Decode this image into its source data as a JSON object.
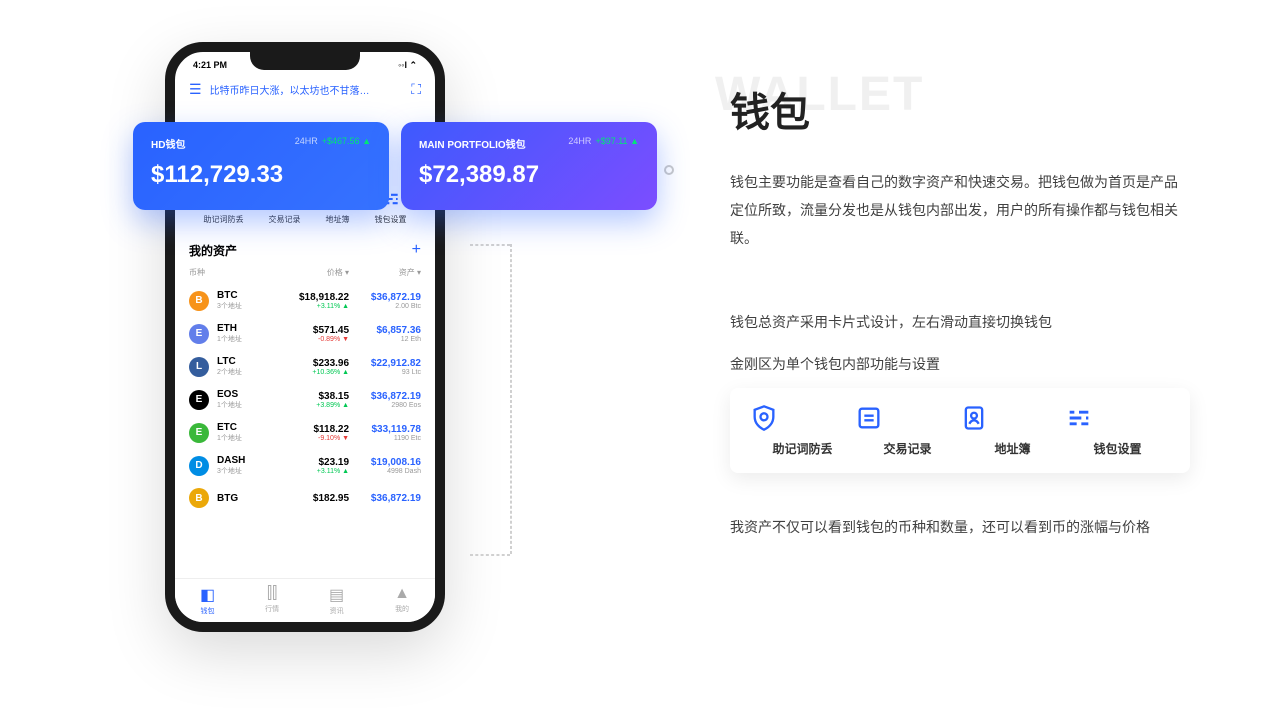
{
  "status": {
    "time": "4:21 PM",
    "signal": "◦◦l ⌃"
  },
  "news_text": "比特币昨日大涨，以太坊也不甘落…",
  "wallet_cards": [
    {
      "name": "HD钱包",
      "period": "24HR",
      "change": "+$467.56",
      "arrow": "▲",
      "amount": "$112,729.33"
    },
    {
      "name": "MAIN PORTFOLIO钱包",
      "period": "24HR",
      "change": "+$97.11",
      "arrow": "▲",
      "amount": "$72,389.87"
    }
  ],
  "actions": [
    {
      "label": "助记词防丢"
    },
    {
      "label": "交易记录"
    },
    {
      "label": "地址簿"
    },
    {
      "label": "钱包设置"
    }
  ],
  "assets_title": "我的资产",
  "col_headers": {
    "c1": "币种",
    "c2": "价格 ▾",
    "c3": "资产 ▾"
  },
  "assets": [
    {
      "sym": "BTC",
      "addr": "3个地址",
      "price": "$18,918.22",
      "change": "+3.11%",
      "dir": "up",
      "value": "$36,872.19",
      "amt": "2.00 Btc",
      "bg": "#f7931a"
    },
    {
      "sym": "ETH",
      "addr": "1个地址",
      "price": "$571.45",
      "change": "-0.89%",
      "dir": "down",
      "value": "$6,857.36",
      "amt": "12 Eth",
      "bg": "#627eea"
    },
    {
      "sym": "LTC",
      "addr": "2个地址",
      "price": "$233.96",
      "change": "+10.36%",
      "dir": "up",
      "value": "$22,912.82",
      "amt": "93 Ltc",
      "bg": "#345d9d"
    },
    {
      "sym": "EOS",
      "addr": "1个地址",
      "price": "$38.15",
      "change": "+3.89%",
      "dir": "up",
      "value": "$36,872.19",
      "amt": "2980 Eos",
      "bg": "#000"
    },
    {
      "sym": "ETC",
      "addr": "1个地址",
      "price": "$118.22",
      "change": "-9.10%",
      "dir": "down",
      "value": "$33,119.78",
      "amt": "1190 Etc",
      "bg": "#3ab83a"
    },
    {
      "sym": "DASH",
      "addr": "3个地址",
      "price": "$23.19",
      "change": "+3.11%",
      "dir": "up",
      "value": "$19,008.16",
      "amt": "4998 Dash",
      "bg": "#008de4"
    },
    {
      "sym": "BTG",
      "addr": "",
      "price": "$182.95",
      "change": "",
      "dir": "up",
      "value": "$36,872.19",
      "amt": "",
      "bg": "#eba809"
    }
  ],
  "tabs": [
    {
      "label": "钱包",
      "active": true
    },
    {
      "label": "行情",
      "active": false
    },
    {
      "label": "资讯",
      "active": false
    },
    {
      "label": "我的",
      "active": false
    }
  ],
  "right": {
    "title_bg": "WALLET",
    "title": "钱包",
    "desc": "钱包主要功能是查看自己的数字资产和快速交易。把钱包做为首页是产品定位所致，流量分发也是从钱包内部出发，用户的所有操作都与钱包相关联。",
    "feature1": "钱包总资产采用卡片式设计，左右滑动直接切换钱包",
    "feature2": "金刚区为单个钱包内部功能与设置",
    "strip": [
      {
        "label": "助记词防丢"
      },
      {
        "label": "交易记录"
      },
      {
        "label": "地址簿"
      },
      {
        "label": "钱包设置"
      }
    ],
    "feature3": "我资产不仅可以看到钱包的币种和数量，还可以看到币的涨幅与价格"
  }
}
